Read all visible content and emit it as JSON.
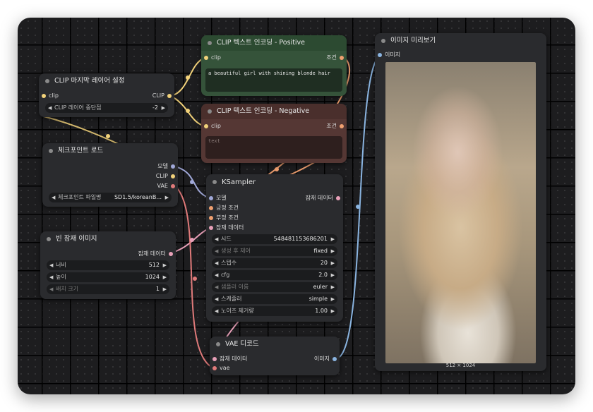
{
  "clip_last_layer": {
    "title": "CLIP 마지막 레이어 설정",
    "input_clip": "clip",
    "output_clip": "CLIP",
    "widget_label": "CLIP 레이어 중단점",
    "widget_value": "-2"
  },
  "clip_positive": {
    "title": "CLIP 텍스트 인코딩 - Positive",
    "input_clip": "clip",
    "output": "조건",
    "text": "a beautiful girl with shining blonde hair"
  },
  "clip_negative": {
    "title": "CLIP 텍스트 인코딩 - Negative",
    "input_clip": "clip",
    "output": "조건",
    "placeholder": "text"
  },
  "checkpoint": {
    "title": "체크포인트 로드",
    "out_model": "모델",
    "out_clip": "CLIP",
    "out_vae": "VAE",
    "widget_label": "체크포인트 파일명",
    "widget_value": "SD1.5/koreanB..."
  },
  "empty_latent": {
    "title": "빈 잠재 이미지",
    "output": "잠재 데이터",
    "width_label": "너비",
    "width_value": "512",
    "height_label": "높이",
    "height_value": "1024",
    "batch_label": "배치 크기",
    "batch_value": "1"
  },
  "ksampler": {
    "title": "KSampler",
    "in_model": "모델",
    "in_positive": "긍정 조건",
    "in_negative": "부정 조건",
    "in_latent": "잠재 데이터",
    "output": "잠재 데이터",
    "widgets": [
      {
        "label": "시드",
        "value": "548481153686201"
      },
      {
        "label": "생성 후 제어",
        "value": "fixed"
      },
      {
        "label": "스텝수",
        "value": "20"
      },
      {
        "label": "cfg",
        "value": "2.0"
      },
      {
        "label": "샘플러 이름",
        "value": "euler"
      },
      {
        "label": "스케줄러",
        "value": "simple"
      },
      {
        "label": "노이즈 제거량",
        "value": "1.00"
      }
    ]
  },
  "vae_decode": {
    "title": "VAE 디코드",
    "in_latent": "잠재 데이터",
    "in_vae": "vae",
    "output": "이미지"
  },
  "preview": {
    "title": "이미지 미리보기",
    "input": "이미지",
    "size_caption": "512 × 1024"
  },
  "colors": {
    "canvas": "#1d1d1f",
    "node": "#2a2b2e",
    "positive_node": "#35533a",
    "negative_node": "#553734",
    "clip_wire": "#f2d27a",
    "model_wire": "#a0a8d8",
    "vae_wire": "#e07a7a",
    "latent_wire": "#e8a0b8",
    "cond_wire": "#f0a070",
    "image_wire": "#8ab4e0"
  }
}
